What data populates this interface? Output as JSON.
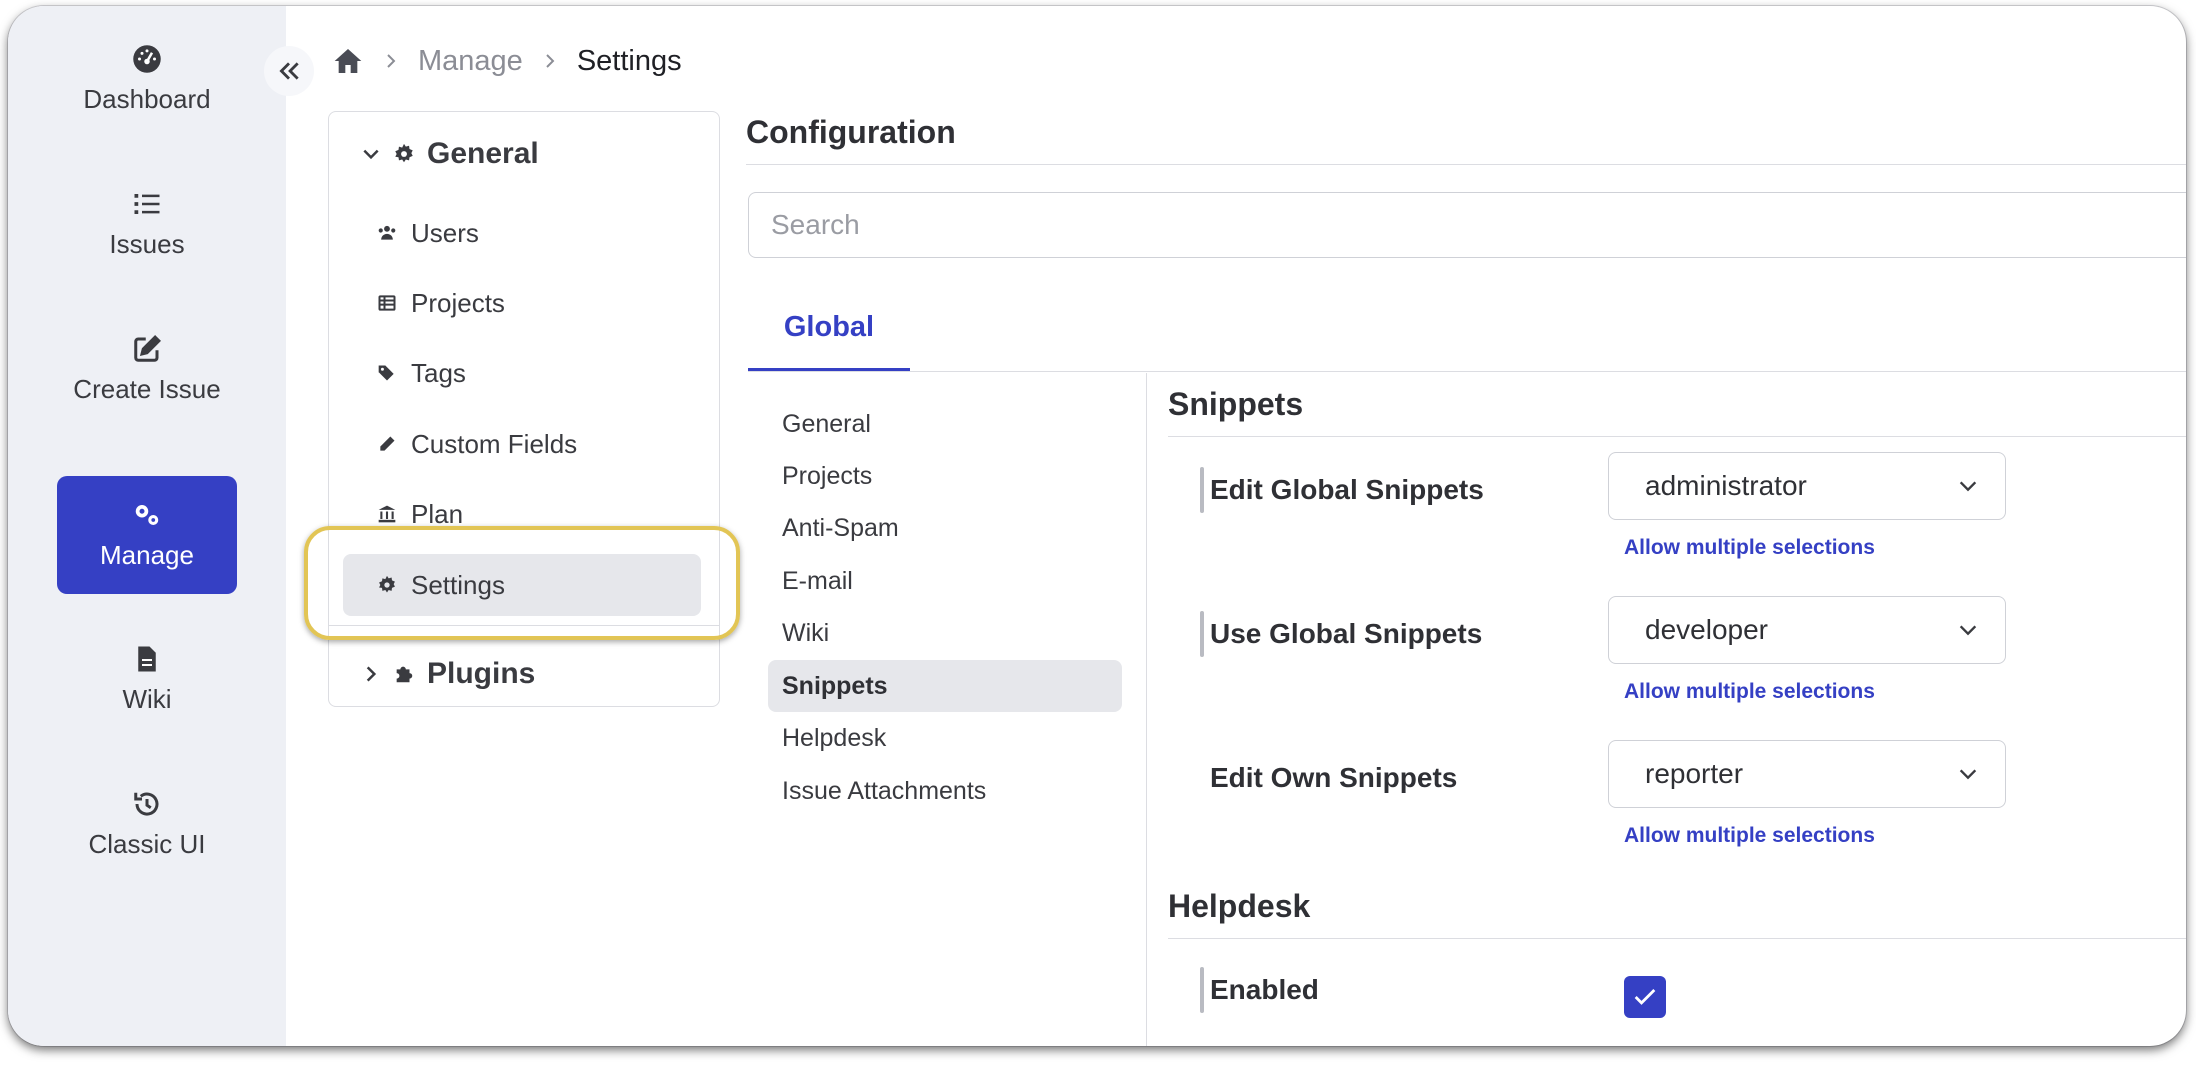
{
  "rail": {
    "items": [
      {
        "label": "Dashboard",
        "icon": "dashboard-icon"
      },
      {
        "label": "Issues",
        "icon": "list-icon"
      },
      {
        "label": "Create Issue",
        "icon": "edit-icon"
      },
      {
        "label": "Manage",
        "icon": "cogs-icon",
        "active": true
      },
      {
        "label": "Wiki",
        "icon": "document-icon"
      },
      {
        "label": "Classic UI",
        "icon": "history-icon"
      }
    ]
  },
  "breadcrumb": {
    "home_icon": "home-icon",
    "manage": "Manage",
    "current": "Settings"
  },
  "tree": {
    "general": "General",
    "items": [
      {
        "label": "Users",
        "icon": "users-icon"
      },
      {
        "label": "Projects",
        "icon": "table-icon"
      },
      {
        "label": "Tags",
        "icon": "tags-icon"
      },
      {
        "label": "Custom Fields",
        "icon": "pencil-icon"
      },
      {
        "label": "Plan",
        "icon": "bank-icon"
      },
      {
        "label": "Settings",
        "icon": "gear-icon"
      }
    ],
    "plugins": "Plugins"
  },
  "config": {
    "title": "Configuration",
    "search_placeholder": "Search",
    "tab": "Global",
    "categories": [
      "General",
      "Projects",
      "Anti-Spam",
      "E-mail",
      "Wiki",
      "Snippets",
      "Helpdesk",
      "Issue Attachments"
    ]
  },
  "snippets": {
    "title": "Snippets",
    "edit_global": {
      "label": "Edit Global Snippets",
      "value": "administrator"
    },
    "use_global": {
      "label": "Use Global Snippets",
      "value": "developer"
    },
    "edit_own": {
      "label": "Edit Own Snippets",
      "value": "reporter"
    },
    "allow_multiple": "Allow multiple selections"
  },
  "helpdesk": {
    "title": "Helpdesk",
    "enabled_label": "Enabled",
    "enabled": true
  },
  "colors": {
    "accent": "#3540c4",
    "rail_bg": "#eef0f5",
    "highlight": "#e2c555"
  }
}
